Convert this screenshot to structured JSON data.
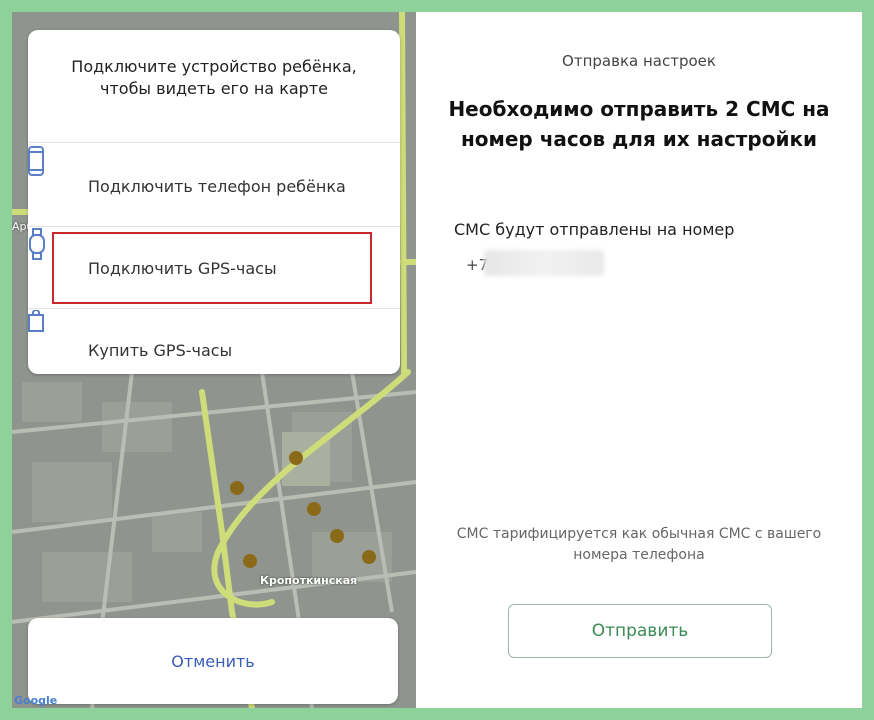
{
  "left_panel": {
    "sheet_title": "Подключите устройство ребёнка,\nчтобы видеть его на карте",
    "items": [
      {
        "label": "Подключить телефон ребёнка",
        "icon": "phone-icon"
      },
      {
        "label": "Подключить GPS-часы",
        "icon": "watch-icon"
      },
      {
        "label": "Купить GPS-часы",
        "icon": "shopping-bag-icon"
      }
    ],
    "cancel_label": "Отменить",
    "map_place_label": "Кропоткинская",
    "map_side_label": "Арб",
    "google_label": "Google"
  },
  "right_panel": {
    "heading": "Отправка настроек",
    "title": "Необходимо отправить 2 СМС на номер часов для их настройки",
    "sub": "СМС будут отправлены на номер",
    "phone_prefix": "+7",
    "note": "СМС тарифицируется как обычная СМС с вашего номера телефона",
    "send_label": "Отправить"
  },
  "colors": {
    "frame_border": "#8fd19a",
    "highlight_border": "#c9262b",
    "cancel_text": "#3b5db8",
    "send_text": "#3a8a54",
    "icon_blue": "#5a7fc8"
  }
}
